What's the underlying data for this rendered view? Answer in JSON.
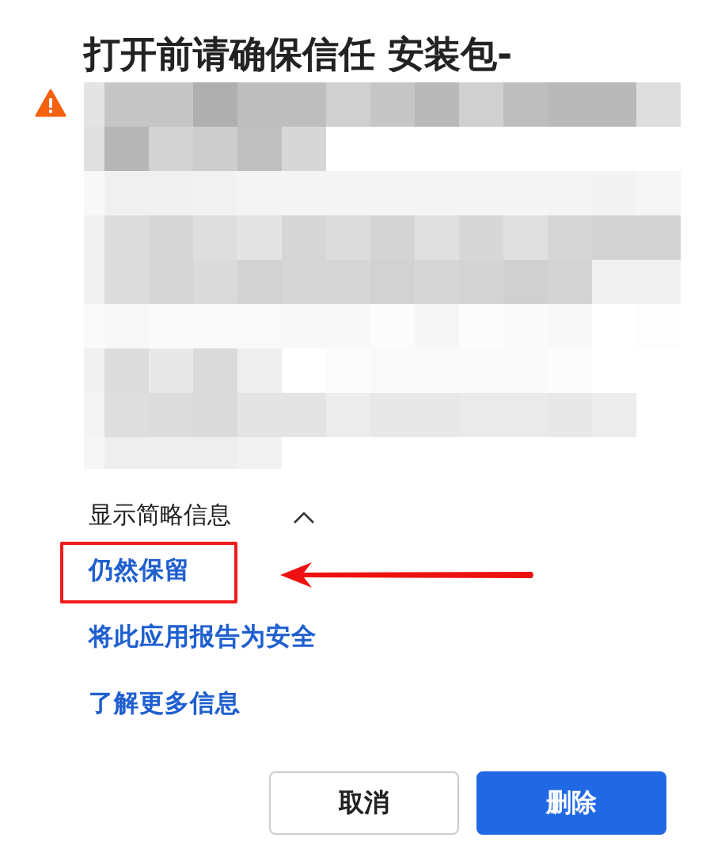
{
  "dialog": {
    "title": "打开前请确保信任 安装包-",
    "details_toggle": {
      "label": "显示简略信息",
      "expanded": true
    },
    "links": [
      {
        "label": "仍然保留",
        "highlighted": true
      },
      {
        "label": "将此应用报告为安全",
        "highlighted": false
      },
      {
        "label": "了解更多信息",
        "highlighted": false
      }
    ],
    "buttons": [
      {
        "label": "取消",
        "kind": "secondary"
      },
      {
        "label": "删除",
        "kind": "primary"
      }
    ]
  }
}
